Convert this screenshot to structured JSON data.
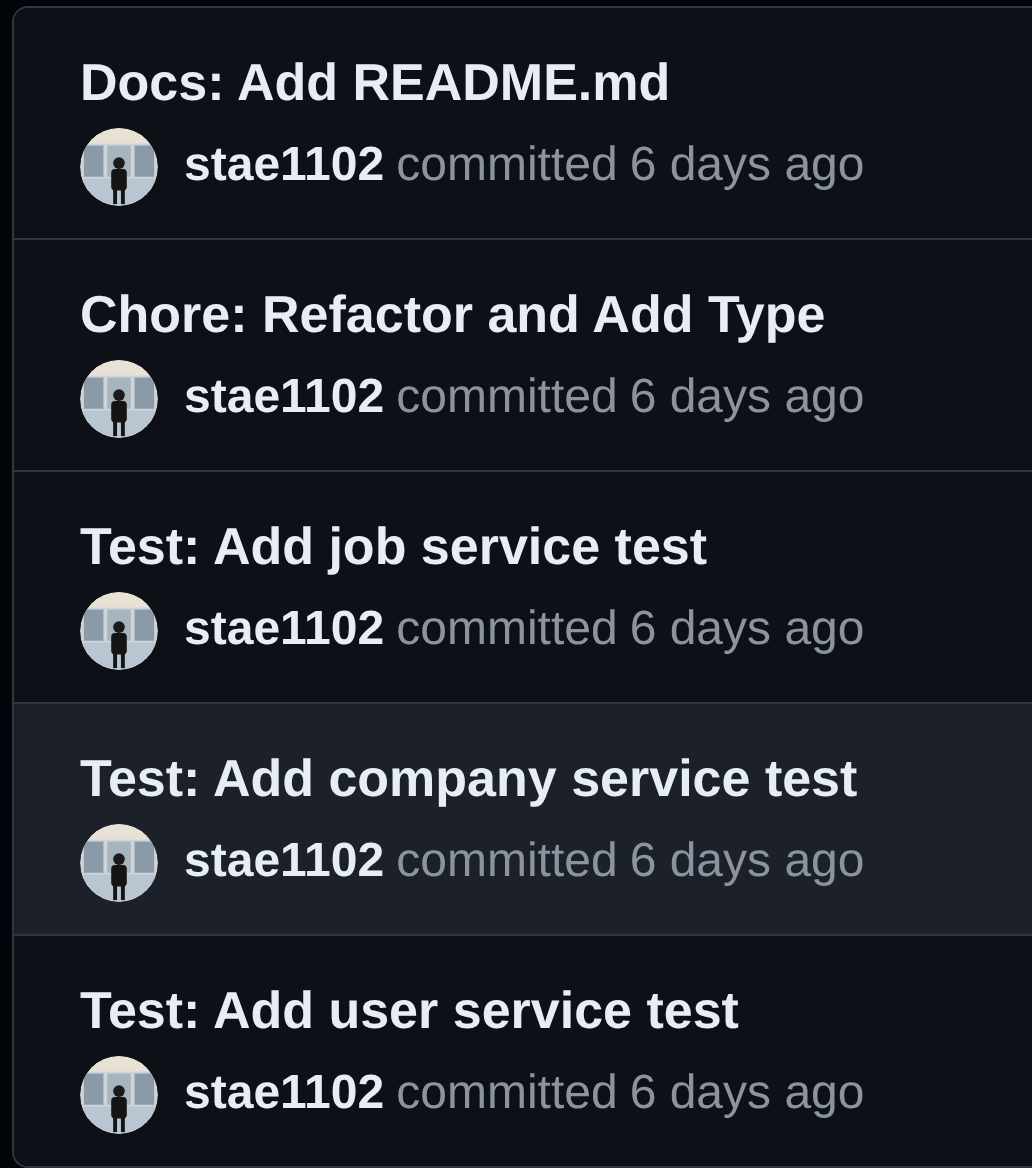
{
  "commits": [
    {
      "message": "Docs: Add README.md",
      "author": "stae1102",
      "action": "committed",
      "time": "6 days ago",
      "highlighted": false
    },
    {
      "message": "Chore: Refactor and Add Type",
      "author": "stae1102",
      "action": "committed",
      "time": "6 days ago",
      "highlighted": false
    },
    {
      "message": "Test: Add job service test",
      "author": "stae1102",
      "action": "committed",
      "time": "6 days ago",
      "highlighted": false
    },
    {
      "message": "Test: Add company service test",
      "author": "stae1102",
      "action": "committed",
      "time": "6 days ago",
      "highlighted": true
    },
    {
      "message": "Test: Add user service test",
      "author": "stae1102",
      "action": "committed",
      "time": "6 days ago",
      "highlighted": false
    }
  ]
}
